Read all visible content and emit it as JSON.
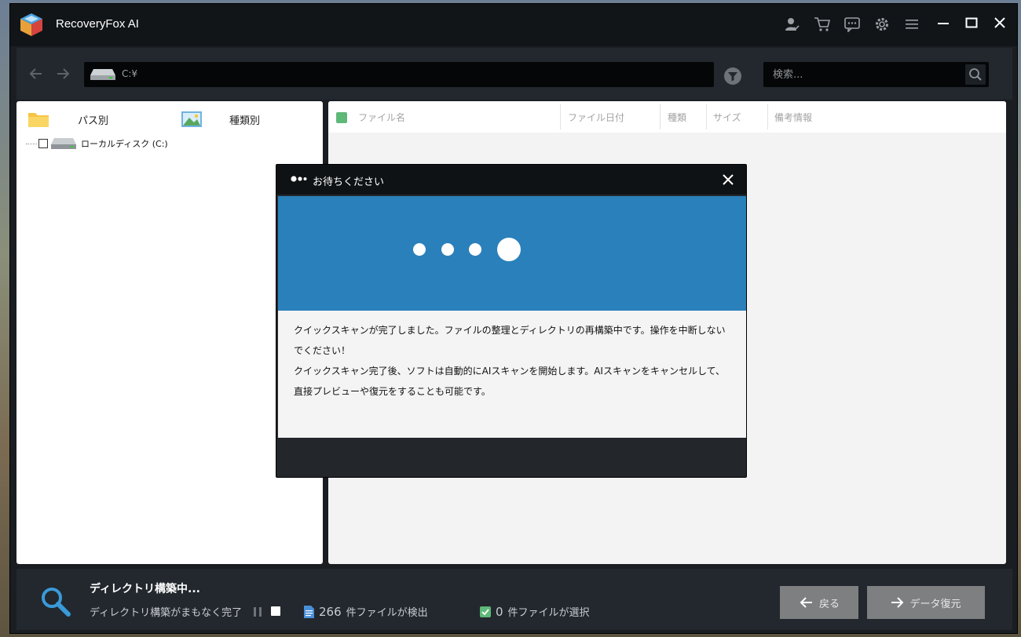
{
  "app": {
    "title": "RecoveryFox AI"
  },
  "toolbar": {
    "path": "C:¥",
    "search_placeholder": "検索..."
  },
  "left_panel": {
    "tabs": [
      {
        "label": "パス別"
      },
      {
        "label": "種類別"
      }
    ],
    "tree": [
      {
        "label": "ローカルディスク (C:)",
        "checked": false
      }
    ]
  },
  "table": {
    "columns": [
      "ファイル名",
      "ファイル日付",
      "種類",
      "サイズ",
      "備考情報"
    ]
  },
  "modal": {
    "title": "お待ちください",
    "message_lines": [
      "クイックスキャンが完了しました。ファイルの整理とディレクトリの再構築中です。操作を中断しないでください！",
      "クイックスキャン完了後、ソフトは自動的にAIスキャンを開始します。AIスキャンをキャンセルして、直接プレビューや復元をすることも可能です。"
    ]
  },
  "status": {
    "title": "ディレクトリ構築中...",
    "subtitle": "ディレクトリ構築がまもなく完了",
    "found_count": "266",
    "found_label": "件ファイルが検出",
    "selected_count": "0",
    "selected_label": "件ファイルが選択"
  },
  "buttons": {
    "back": "戻る",
    "recover": "データ復元"
  },
  "colors": {
    "accent_blue": "#2a80bb",
    "check_green": "#5fb878",
    "button_gray": "#7d7f81"
  }
}
